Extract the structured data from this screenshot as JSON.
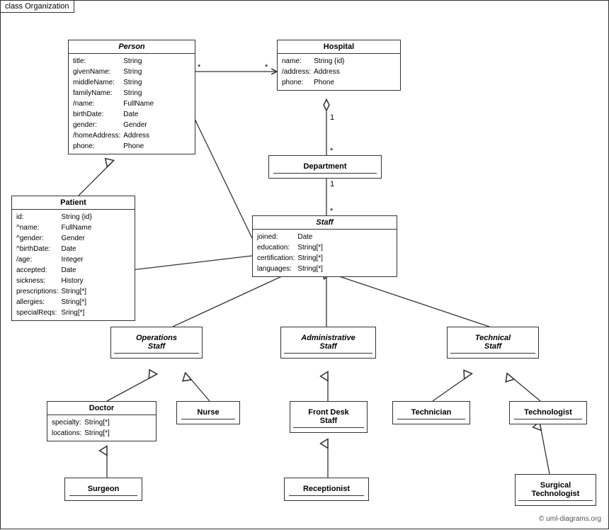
{
  "diagram": {
    "title": "class Organization",
    "watermark": "© uml-diagrams.org",
    "classes": {
      "person": {
        "name": "Person",
        "italic": true,
        "attributes": [
          [
            "title:",
            "String"
          ],
          [
            "givenName:",
            "String"
          ],
          [
            "middleName:",
            "String"
          ],
          [
            "familyName:",
            "String"
          ],
          [
            "/name:",
            "FullName"
          ],
          [
            "birthDate:",
            "Date"
          ],
          [
            "gender:",
            "Gender"
          ],
          [
            "/homeAddress:",
            "Address"
          ],
          [
            "phone:",
            "Phone"
          ]
        ]
      },
      "hospital": {
        "name": "Hospital",
        "italic": false,
        "attributes": [
          [
            "name:",
            "String {id}"
          ],
          [
            "/address:",
            "Address"
          ],
          [
            "phone:",
            "Phone"
          ]
        ]
      },
      "patient": {
        "name": "Patient",
        "italic": false,
        "attributes": [
          [
            "id:",
            "String {id}"
          ],
          [
            "^name:",
            "FullName"
          ],
          [
            "^gender:",
            "Gender"
          ],
          [
            "^birthDate:",
            "Date"
          ],
          [
            "/age:",
            "Integer"
          ],
          [
            "accepted:",
            "Date"
          ],
          [
            "sickness:",
            "History"
          ],
          [
            "prescriptions:",
            "String[*]"
          ],
          [
            "allergies:",
            "String[*]"
          ],
          [
            "specialReqs:",
            "Sring[*]"
          ]
        ]
      },
      "department": {
        "name": "Department",
        "italic": false,
        "attributes": []
      },
      "staff": {
        "name": "Staff",
        "italic": true,
        "attributes": [
          [
            "joined:",
            "Date"
          ],
          [
            "education:",
            "String[*]"
          ],
          [
            "certification:",
            "String[*]"
          ],
          [
            "languages:",
            "String[*]"
          ]
        ]
      },
      "operations_staff": {
        "name": "Operations\nStaff",
        "italic": true,
        "attributes": []
      },
      "administrative_staff": {
        "name": "Administrative\nStaff",
        "italic": true,
        "attributes": []
      },
      "technical_staff": {
        "name": "Technical\nStaff",
        "italic": true,
        "attributes": []
      },
      "doctor": {
        "name": "Doctor",
        "italic": false,
        "attributes": [
          [
            "specialty:",
            "String[*]"
          ],
          [
            "locations:",
            "String[*]"
          ]
        ]
      },
      "nurse": {
        "name": "Nurse",
        "italic": false,
        "attributes": []
      },
      "front_desk_staff": {
        "name": "Front Desk\nStaff",
        "italic": false,
        "attributes": []
      },
      "technician": {
        "name": "Technician",
        "italic": false,
        "attributes": []
      },
      "technologist": {
        "name": "Technologist",
        "italic": false,
        "attributes": []
      },
      "surgeon": {
        "name": "Surgeon",
        "italic": false,
        "attributes": []
      },
      "receptionist": {
        "name": "Receptionist",
        "italic": false,
        "attributes": []
      },
      "surgical_technologist": {
        "name": "Surgical\nTechnologist",
        "italic": false,
        "attributes": []
      }
    }
  }
}
